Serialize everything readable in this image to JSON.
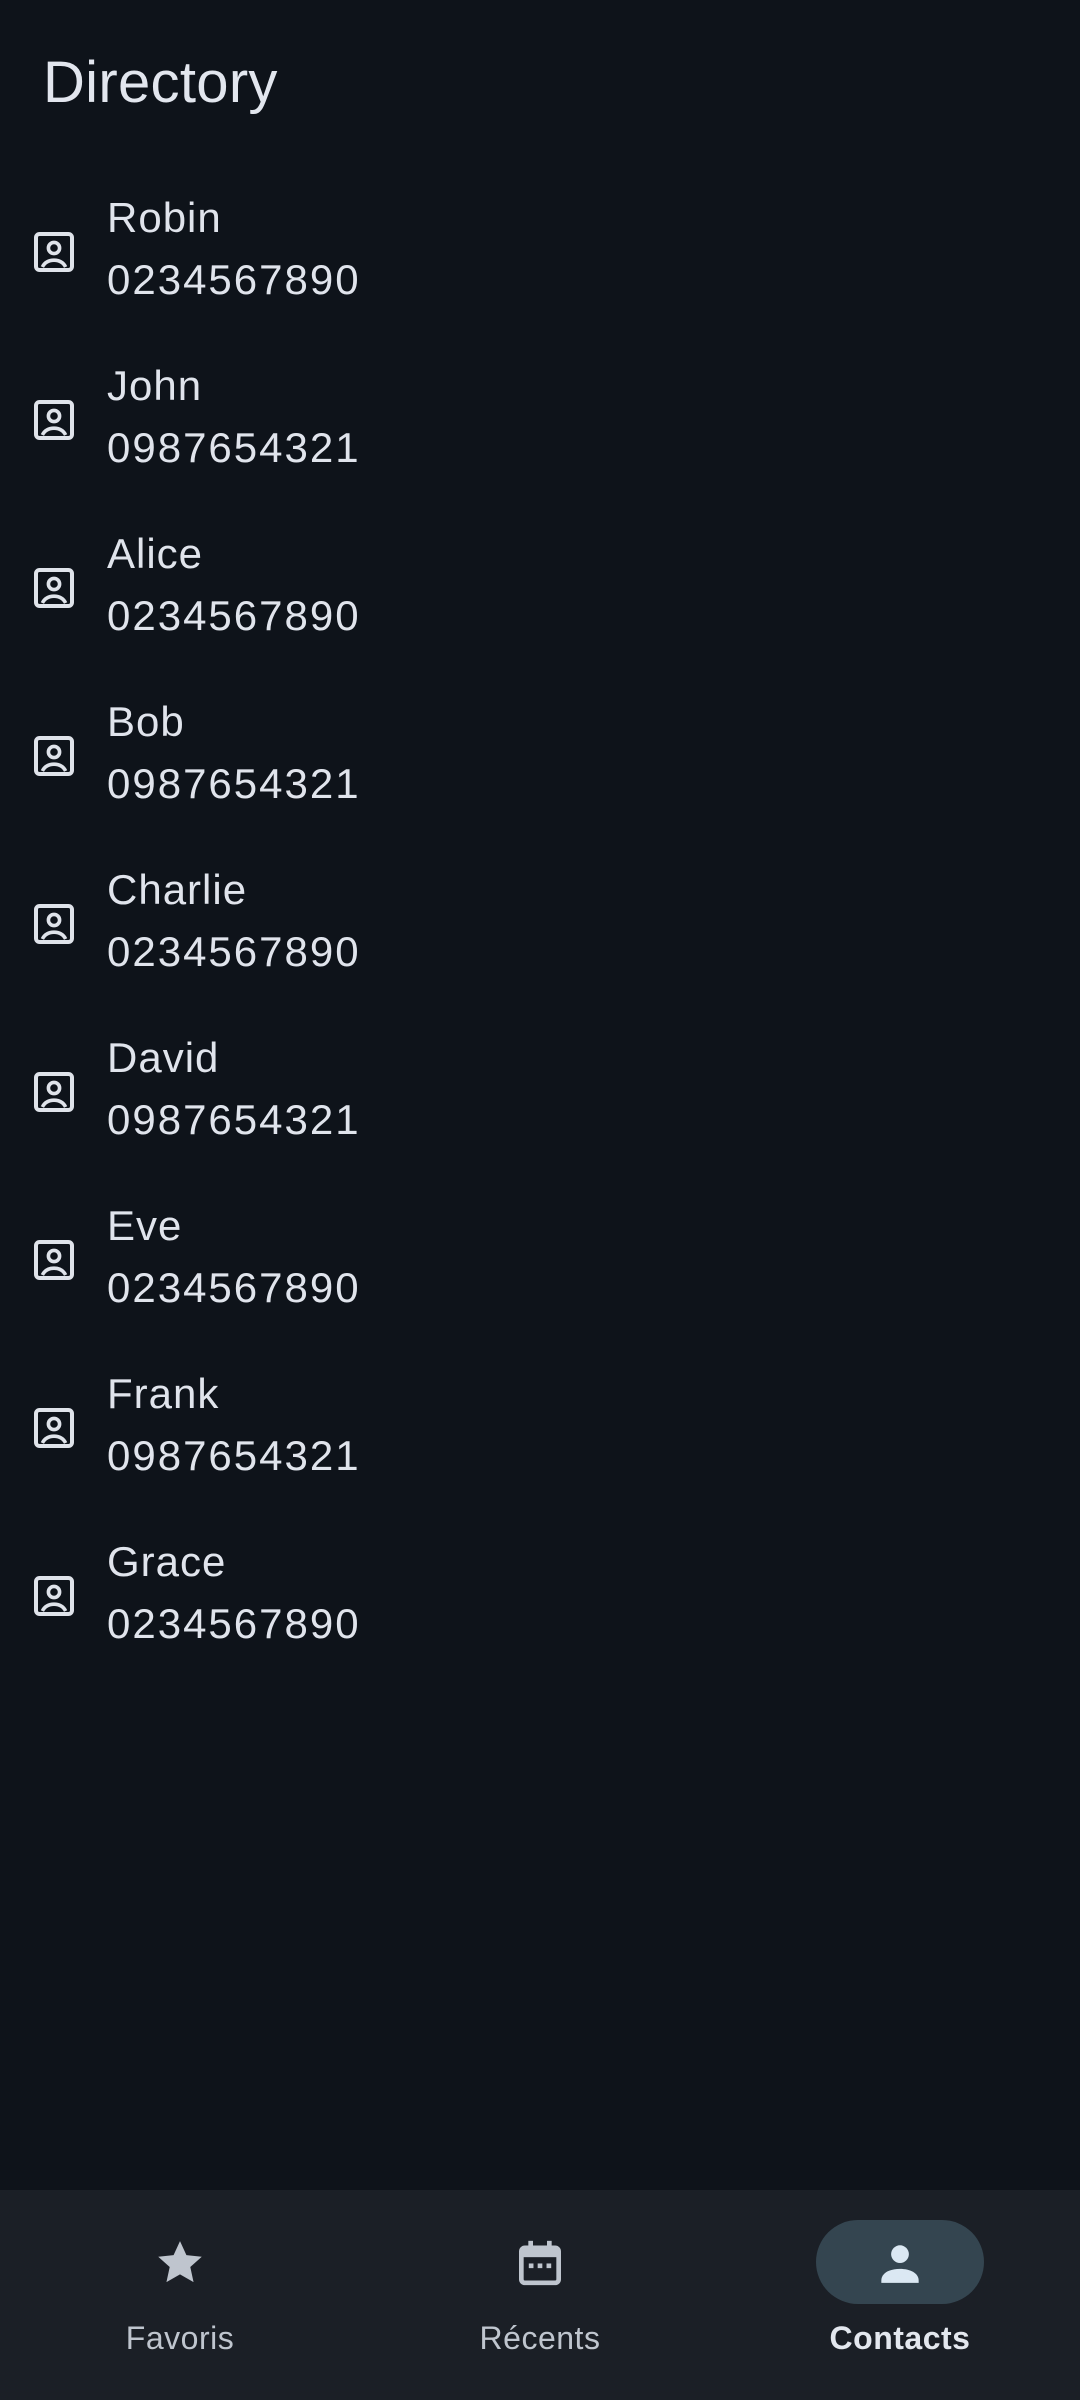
{
  "header": {
    "title": "Directory"
  },
  "contacts": [
    {
      "name": "Robin",
      "phone": "0234567890"
    },
    {
      "name": "John",
      "phone": "0987654321"
    },
    {
      "name": "Alice",
      "phone": "0234567890"
    },
    {
      "name": "Bob",
      "phone": "0987654321"
    },
    {
      "name": "Charlie",
      "phone": "0234567890"
    },
    {
      "name": "David",
      "phone": "0987654321"
    },
    {
      "name": "Eve",
      "phone": "0234567890"
    },
    {
      "name": "Frank",
      "phone": "0987654321"
    },
    {
      "name": "Grace",
      "phone": "0234567890"
    }
  ],
  "contact_icon": "contact-card-icon",
  "bottom_nav": {
    "items": [
      {
        "label": "Favoris",
        "icon": "star-icon",
        "active": false
      },
      {
        "label": "Récents",
        "icon": "calendar-icon",
        "active": false
      },
      {
        "label": "Contacts",
        "icon": "person-icon",
        "active": true
      }
    ]
  },
  "colors": {
    "background": "#0e131a",
    "nav_background": "#1b1f26",
    "active_pill": "#344550",
    "text": "#e0e4ec",
    "nav_icon": "#bfc5ce",
    "active_icon": "#dbe8f3"
  }
}
